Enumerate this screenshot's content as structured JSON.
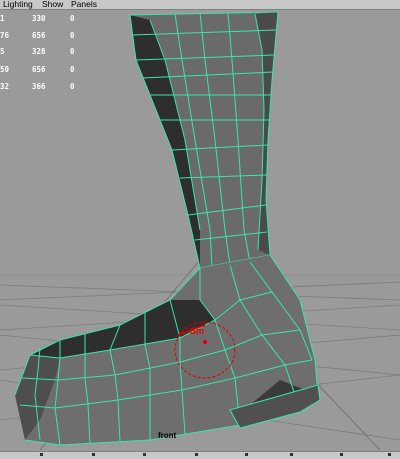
{
  "menu": {
    "items": [
      "Lighting",
      "Show",
      "Panels"
    ]
  },
  "hud": {
    "rows": [
      {
        "label": "1",
        "a": "330",
        "b": "0"
      },
      {
        "label": "76",
        "a": "656",
        "b": "0"
      },
      {
        "label": "5",
        "a": "328",
        "b": "0"
      },
      {
        "label": "50",
        "a": "656",
        "b": "0"
      },
      {
        "label": "32",
        "a": "366",
        "b": "0"
      }
    ]
  },
  "manipulator": {
    "label": "Sm",
    "color": "#e00000"
  },
  "viewport": {
    "camera_label": "front"
  },
  "colors": {
    "wireframe": "#39e6a6",
    "mesh_light": "#6e6e6e",
    "mesh_dark": "#2e2e2e",
    "background": "#9a9a9a",
    "grid": "#7a7a7a"
  }
}
